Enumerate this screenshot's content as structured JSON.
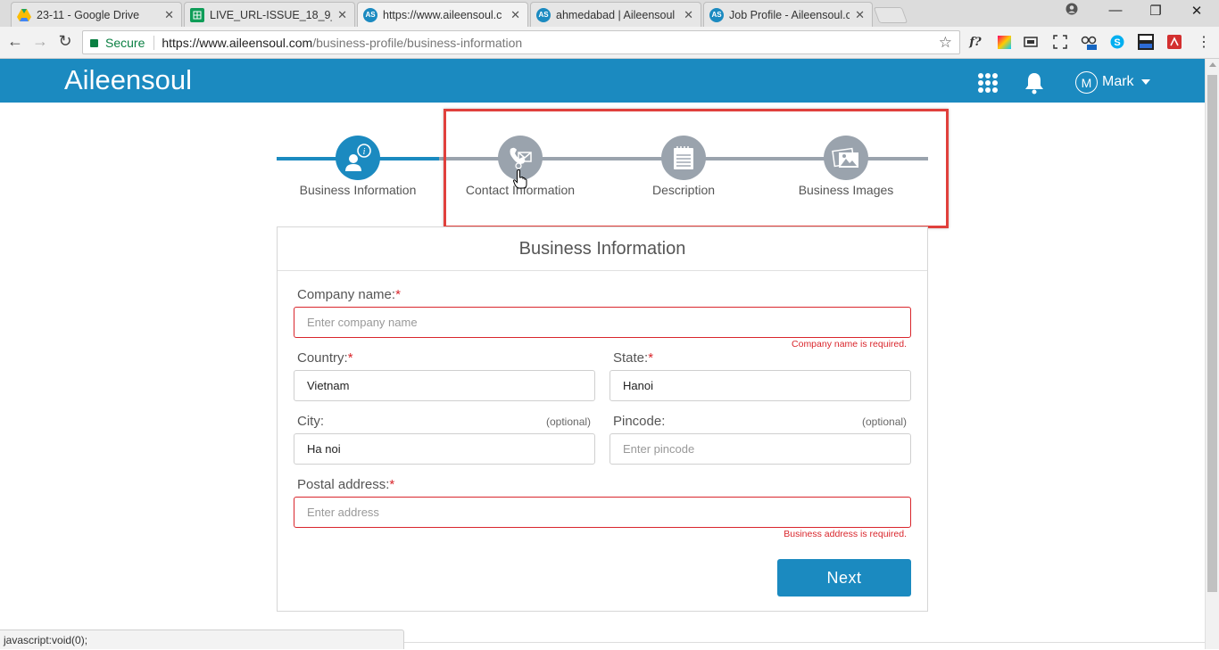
{
  "browser": {
    "tabs": [
      {
        "title": "23-11 - Google Drive",
        "icon": "google-drive-icon",
        "close": "✕"
      },
      {
        "title": "LIVE_URL-ISSUE_18_9_20",
        "icon": "sheets-icon",
        "close": "✕"
      },
      {
        "title": "https://www.aileensoul.c",
        "icon": "aileensoul-icon",
        "close": "✕"
      },
      {
        "title": "ahmedabad | Aileensoul",
        "icon": "aileensoul-icon",
        "close": "✕"
      },
      {
        "title": "Job Profile - Aileensoul.c",
        "icon": "aileensoul-icon",
        "close": "✕"
      }
    ],
    "favicon_text": "AS",
    "secure_label": "Secure",
    "url_host": "https://www.aileensoul.com",
    "url_path": "/business-profile/business-information",
    "status_text": "javascript:void(0);"
  },
  "header": {
    "logo": "Aileensoul",
    "user_initial": "M",
    "user_name": "Mark"
  },
  "stepper": {
    "steps": [
      {
        "label": "Business Information",
        "active": true
      },
      {
        "label": "Contact Information",
        "active": false
      },
      {
        "label": "Description",
        "active": false
      },
      {
        "label": "Business Images",
        "active": false
      }
    ]
  },
  "form": {
    "title": "Business Information",
    "company": {
      "label": "Company name:",
      "required": "*",
      "placeholder": "Enter company name",
      "error": "Company name is required."
    },
    "country": {
      "label": "Country:",
      "required": "*",
      "value": "Vietnam"
    },
    "state": {
      "label": "State:",
      "required": "*",
      "value": "Hanoi"
    },
    "city": {
      "label": "City:",
      "optional": "(optional)",
      "value": "Ha noi"
    },
    "pincode": {
      "label": "Pincode:",
      "optional": "(optional)",
      "placeholder": "Enter pincode"
    },
    "postal": {
      "label": "Postal address:",
      "required": "*",
      "placeholder": "Enter address",
      "error": "Business address is required."
    },
    "next_label": "Next"
  },
  "colors": {
    "brand": "#1b8ac0",
    "step_active": "#1b8ac0",
    "step_inactive": "#9aa3ad",
    "error": "#d9262c",
    "highlight": "#e0403c"
  }
}
